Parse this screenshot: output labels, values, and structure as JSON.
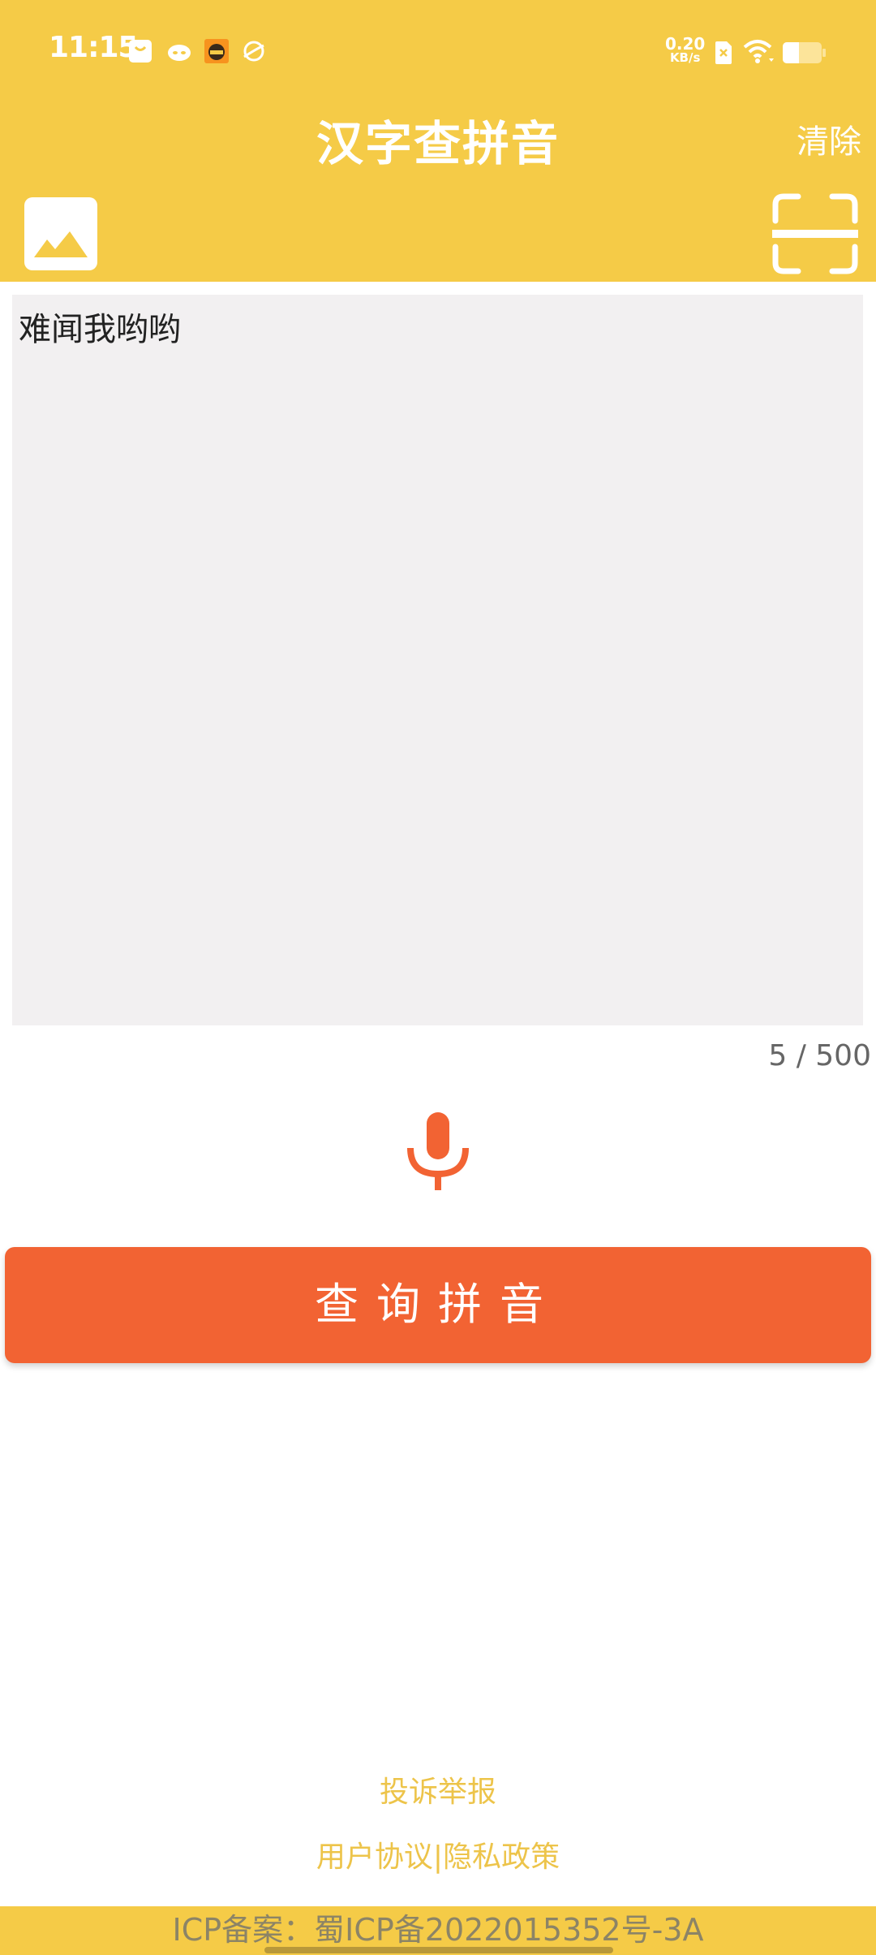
{
  "status_bar": {
    "time": "11:15",
    "notification_icons": [
      "shopping-bag-icon",
      "cat-app-icon",
      "game-monkey-icon",
      "planet-browser-icon"
    ],
    "net_speed_value": "0.20",
    "net_speed_unit": "KB/s",
    "sim_status": "no-sim-icon",
    "wifi": "wifi-icon",
    "battery_level_percent": 40
  },
  "header": {
    "title": "汉字查拼音",
    "clear_label": "清除",
    "image_button": "image-icon",
    "scan_button": "scan-icon"
  },
  "input": {
    "value": "难闻我哟哟",
    "char_count": "5 / 500"
  },
  "actions": {
    "voice_button": "microphone-icon",
    "query_label": "查询拼音"
  },
  "links": {
    "report": "投诉举报",
    "user_agreement": "用户协议",
    "separator": "|",
    "privacy_policy": "隐私政策"
  },
  "footer": {
    "icp_text": "ICP备案：蜀ICP备2022015352号-3A"
  },
  "colors": {
    "brand_yellow": "#F5CB47",
    "accent_orange": "#F26333",
    "link_yellow": "#EDC44A",
    "input_bg": "#F2F0F1"
  }
}
